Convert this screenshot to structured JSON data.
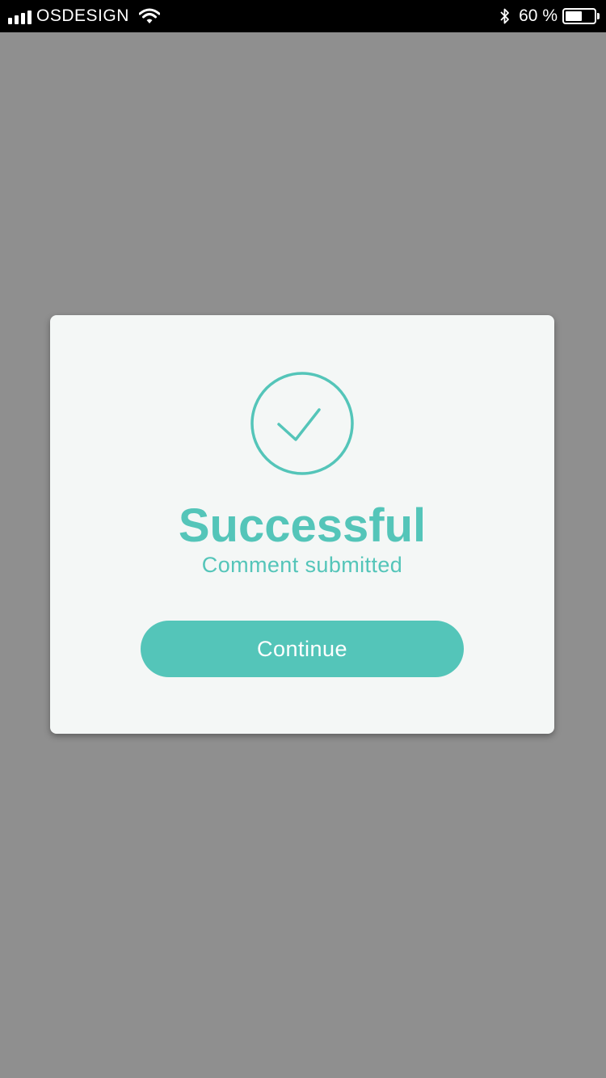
{
  "status_bar": {
    "carrier": "OSDESIGN",
    "battery_percent": "60 %",
    "battery_level": 0.6
  },
  "dialog": {
    "title": "Successful",
    "subtitle": "Comment submitted",
    "continue_label": "Continue",
    "icon": "check-circle-icon"
  },
  "colors": {
    "accent": "#54c5b9",
    "overlay": "#8f8f8f",
    "card": "#f4f7f6"
  }
}
